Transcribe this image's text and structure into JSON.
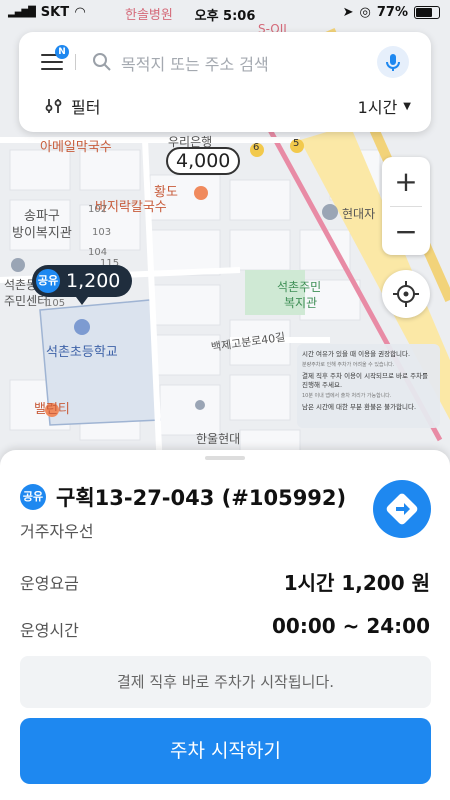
{
  "status_bar": {
    "carrier": "SKT",
    "time": "오후 5:06",
    "battery": "77%",
    "top_left_label": "한솔병원"
  },
  "search": {
    "notification_badge": "N",
    "placeholder": "목적지 또는 주소 검색",
    "filter_label": "필터",
    "duration_selected": "1시간"
  },
  "map": {
    "labels": {
      "amail": "아메일막국수",
      "uribank": "우리은행",
      "hwangdo": "황도",
      "bajirak": "바지락칼국수",
      "songpagu": "송파구",
      "bangi_welfare": "방이복지관",
      "seokchon_center_a": "석촌동",
      "seokchon_center_b": "주민센터",
      "seokchon_school": "석촌초등학교",
      "seokchon_welfare_a": "석촌주민",
      "seokchon_welfare_b": "복지관",
      "hyundai": "현대자",
      "baekje_road": "백제고분로40길",
      "hanol_hyundai": "한울현대",
      "ballenti": "밸런티",
      "soil": "S-OIL",
      "n102": "102",
      "n103": "103",
      "n104": "104",
      "n105": "105",
      "n115": "115",
      "route6": "6",
      "route5": "5"
    },
    "price_marker": "4,000",
    "main_marker": {
      "badge": "공유",
      "price": "1,200"
    },
    "notice_lines": [
      "시간 여유가 있을 때 이용을 권장합니다.",
      "결제 직후 주차 이용이 시작되므로 바로 주차를 진행해 주세요.",
      "남은 시간에 대한 부분 환불은 불가합니다."
    ],
    "notice_small": [
      "분량주차로 인해 주차가 어려울 수 있습니다.",
      "10분 이내 앱에서 출차 처리가 가능합니다."
    ]
  },
  "sheet": {
    "badge": "공유",
    "title": "구획13-27-043 (#105992)",
    "subtitle": "거주자우선",
    "fee_label": "운영요금",
    "fee_value": "1시간 1,200 원",
    "hours_label": "운영시간",
    "hours_value": "00:00 ~ 24:00",
    "hint": "결제 직후 바로 주차가 시작됩니다.",
    "start_button": "주차 시작하기"
  },
  "colors": {
    "accent": "#1e88f0",
    "marker_dark": "#1f2d3d"
  }
}
